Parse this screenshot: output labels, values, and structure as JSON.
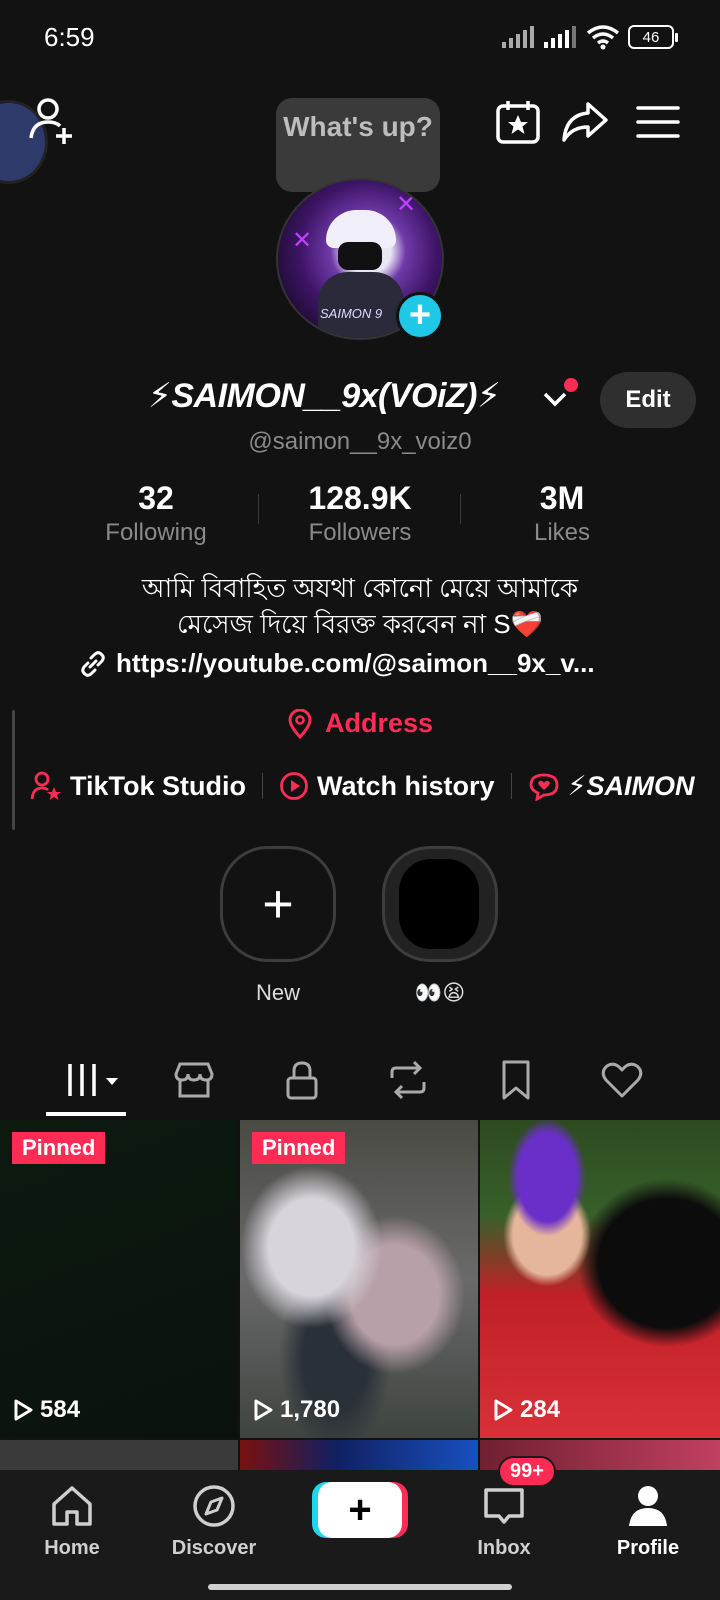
{
  "status_bar": {
    "time": "6:59",
    "battery": "46"
  },
  "top_bar": {
    "bubble_text": "What's up?"
  },
  "profile": {
    "display_name": "⚡SAIMON__9x(VOiZ)⚡",
    "avatar_tag": "SAIMON 9",
    "handle": "@saimon__9x_voiz0",
    "edit_label": "Edit",
    "stats": [
      {
        "value": "32",
        "label": "Following"
      },
      {
        "value": "128.9K",
        "label": "Followers"
      },
      {
        "value": "3M",
        "label": "Likes"
      }
    ],
    "bio_line1": "আমি বিবাহিত অযথা কোনো মেয়ে আমাকে",
    "bio_line2": "মেসেজ দিয়ে বিরক্ত করবেন না S❤️‍🩹",
    "link": "https://youtube.com/@saimon__9x_v...",
    "address": "Address"
  },
  "shortcuts": [
    {
      "label": "TikTok Studio",
      "icon": "person-star-icon"
    },
    {
      "label": "Watch history",
      "icon": "play-circle-icon"
    },
    {
      "label": "⚡SAIMON",
      "icon": "chat-heart-icon"
    }
  ],
  "stories": [
    {
      "label": "New"
    },
    {
      "label": "👀😫"
    }
  ],
  "tabs": [
    "videos",
    "shop",
    "private",
    "reposts",
    "favorites",
    "liked"
  ],
  "videos": [
    {
      "pinned": "Pinned",
      "views": "584"
    },
    {
      "pinned": "Pinned",
      "views": "1,780"
    },
    {
      "pinned": "",
      "views": "284"
    }
  ],
  "nav": {
    "home": "Home",
    "discover": "Discover",
    "inbox": "Inbox",
    "inbox_badge": "99+",
    "profile": "Profile"
  },
  "colors": {
    "accent": "#fe2c55",
    "cyan": "#20d5ec",
    "background": "#121212"
  }
}
